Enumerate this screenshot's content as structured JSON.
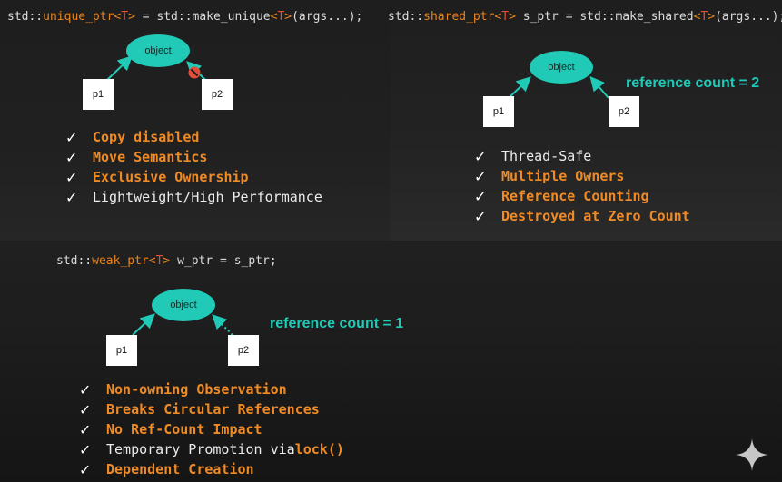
{
  "unique": {
    "code": {
      "prefix": "std::",
      "type_name": "unique_ptr",
      "lt": "<",
      "tparam": "T",
      "gt": ">",
      "middle": " = std::make_unique",
      "lt2": "<",
      "tparam2": "T",
      "gt2": ">",
      "suffix": "(args...);"
    },
    "diagram": {
      "object_label": "object",
      "p1": "p1",
      "p2": "p2"
    },
    "features": [
      {
        "text": "Copy disabled",
        "style": "orange"
      },
      {
        "text": "Move Semantics",
        "style": "orange"
      },
      {
        "text": "Exclusive Ownership",
        "style": "orange"
      },
      {
        "text": "Lightweight/High Performance",
        "style": "white"
      }
    ]
  },
  "shared": {
    "code": {
      "prefix": "std::",
      "type_name": "shared_ptr",
      "lt": "<",
      "tparam": "T",
      "gt": ">",
      "middle": " s_ptr = std::make_shared",
      "lt2": "<",
      "tparam2": "T",
      "gt2": ">",
      "suffix": "(args...);"
    },
    "diagram": {
      "object_label": "object",
      "p1": "p1",
      "p2": "p2",
      "ref_count": "reference count = 2"
    },
    "features": [
      {
        "text": "Thread-Safe",
        "style": "white"
      },
      {
        "text": "Multiple Owners",
        "style": "orange"
      },
      {
        "text": "Reference Counting",
        "style": "orange"
      },
      {
        "text": "Destroyed at Zero Count",
        "style": "orange"
      }
    ]
  },
  "weak": {
    "code": {
      "prefix": "std::",
      "type_name": "weak_ptr",
      "lt": "<",
      "tparam": "T",
      "gt": ">",
      "suffix": " w_ptr = s_ptr;"
    },
    "diagram": {
      "object_label": "object",
      "p1": "p1",
      "p2": "p2",
      "ref_count": "reference count = 1"
    },
    "features": [
      {
        "text": "Non-owning Observation",
        "style": "orange"
      },
      {
        "text": "Breaks Circular References",
        "style": "orange"
      },
      {
        "text": "No Ref-Count Impact",
        "style": "orange"
      },
      {
        "text": "Temporary Promotion via ",
        "highlight": "lock()",
        "style": "white"
      },
      {
        "text": "Dependent Creation",
        "style": "orange"
      }
    ]
  },
  "icons": {
    "check": "checkmark-icon",
    "blocked": "blocked-icon",
    "sparkle": "sparkle-icon"
  },
  "colors": {
    "teal": "#21c9b7",
    "orange": "#ef8a25",
    "red": "#e24d3a"
  }
}
